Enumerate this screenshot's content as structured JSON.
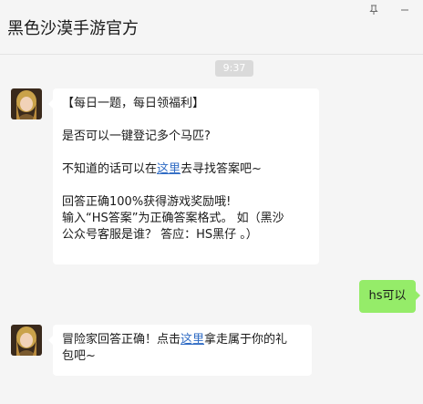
{
  "header": {
    "title": "黑色沙漠手游官方",
    "pin_icon": "pin-icon",
    "minimize_icon": "minimize-icon"
  },
  "timestamp": "9:37",
  "messages": [
    {
      "sender": "official",
      "lines": {
        "l1": "【每日一题，每日领福利】",
        "l2": "是否可以一键登记多个马匹?",
        "l3_pre": "不知道的话可以在",
        "l3_link": "这里",
        "l3_post": "去寻找答案吧~",
        "l4": "回答正确100%获得游戏奖励哦!",
        "l5": "输入“HS答案”为正确答案格式。 如（黑沙",
        "l6": "公众号客服是谁？ 答应：HS黑仔 。）"
      }
    },
    {
      "sender": "self",
      "text": "hs可以"
    },
    {
      "sender": "official",
      "lines": {
        "pre": "冒险家回答正确！点击",
        "link": "这里",
        "post": "拿走属于你的礼",
        "l2": "包吧~"
      }
    }
  ],
  "colors": {
    "background": "#f5f5f5",
    "bubble_in": "#ffffff",
    "bubble_out": "#95ec69",
    "link": "#2f6bc4"
  }
}
